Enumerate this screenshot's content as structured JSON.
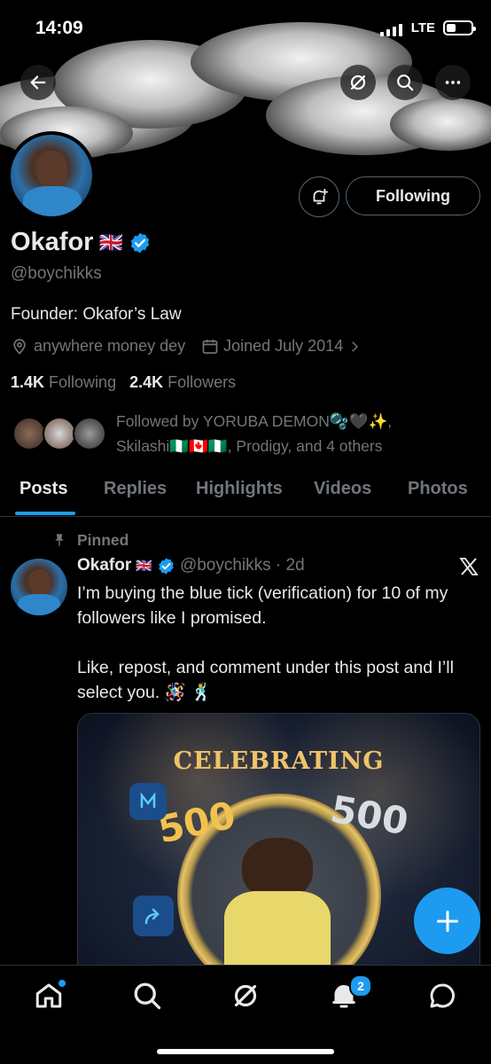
{
  "status_bar": {
    "time": "14:09",
    "network": "LTE"
  },
  "profile": {
    "name": "Okafor",
    "flag": "🇬🇧",
    "handle": "@boychikks",
    "bio": "Founder: Okafor’s Law",
    "location": "anywhere money dey",
    "joined": "Joined July 2014",
    "following_count": "1.4K",
    "following_label": "Following",
    "followers_count": "2.4K",
    "followers_label": "Followers",
    "followed_by_line1": "Followed by YORUBA DEMON🫧🖤✨,",
    "followed_by_line2": "Skilashi🇳🇬🇨🇦🇳🇬, Prodigy, and 4 others"
  },
  "actions": {
    "follow_button": "Following"
  },
  "tabs": [
    "Posts",
    "Replies",
    "Highlights",
    "Videos",
    "Photos"
  ],
  "pinned_post": {
    "pinned_label": "Pinned",
    "author": "Okafor",
    "flag": "🇬🇧",
    "handle_time": "@boychikks · 2d",
    "text": "I’m buying the blue tick (verification) for 10 of my followers like I promised.\n\nLike, repost, and comment under this post and I’ll select you. 🪅 🕺",
    "media": {
      "banner_text": "CELEBRATING",
      "left_number": "500",
      "right_number": "500"
    }
  },
  "bottom_nav": {
    "notifications_badge": "2"
  },
  "colors": {
    "accent": "#1d9bf0",
    "background": "#000000",
    "muted": "#71767b"
  }
}
